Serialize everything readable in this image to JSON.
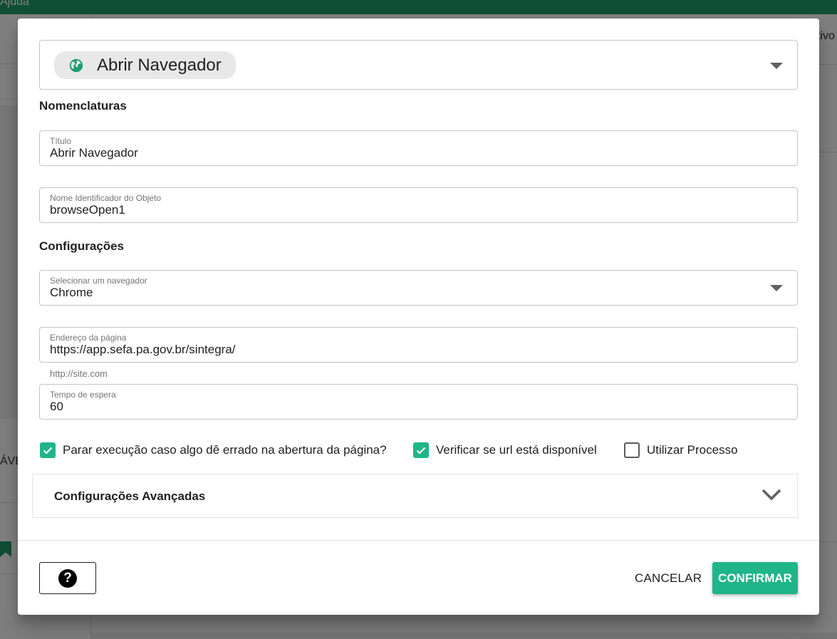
{
  "background": {
    "topbar_text": "Ajuda",
    "left_fragment": "ÁVE",
    "right_fragment": "tivo"
  },
  "dialog": {
    "action": {
      "label": "Abrir Navegador",
      "icon": "globe-icon"
    },
    "nomenclaturas": {
      "section_title": "Nomenclaturas",
      "titulo_label": "Título",
      "titulo_value": "Abrir Navegador",
      "nome_label": "Nome Identificador do Objeto",
      "nome_value": "browseOpen1"
    },
    "configuracoes": {
      "section_title": "Configurações",
      "navegador_label": "Selecionar um navegador",
      "navegador_value": "Chrome",
      "endereco_label": "Endereço da página",
      "endereco_value": "https://app.sefa.pa.gov.br/sintegra/",
      "endereco_helper": "http://site.com",
      "tempo_label": "Tempo de espera",
      "tempo_value": "60"
    },
    "checkboxes": [
      {
        "label": "Parar execução caso algo dê errado na abertura da página?",
        "checked": true
      },
      {
        "label": "Verificar se url está disponível",
        "checked": true
      },
      {
        "label": "Utilizar Processo",
        "checked": false
      }
    ],
    "advanced": {
      "title": "Configurações Avançadas"
    },
    "footer": {
      "help_symbol": "?",
      "cancel_label": "CANCELAR",
      "confirm_label": "CONFIRMAR"
    }
  },
  "colors": {
    "accent": "#1fb589",
    "topbar": "#1f9c6e"
  }
}
